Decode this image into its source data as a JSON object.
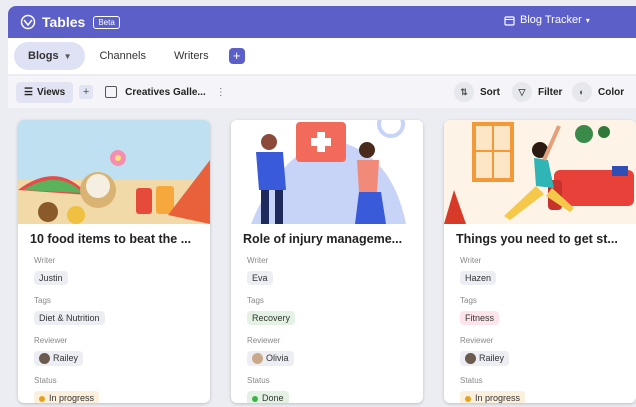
{
  "header": {
    "app_title": "Tables",
    "beta_badge": "Beta",
    "tracker_label": "Blog Tracker",
    "tracker_chevron": "▾"
  },
  "tabs": [
    {
      "label": "Blogs",
      "active": true
    },
    {
      "label": "Channels",
      "active": false
    },
    {
      "label": "Writers",
      "active": false
    }
  ],
  "toolbar": {
    "views_label": "Views",
    "view_name": "Creatives Galle...",
    "sort_label": "Sort",
    "filter_label": "Filter",
    "color_label": "Color"
  },
  "field_labels": {
    "writer": "Writer",
    "tags": "Tags",
    "reviewer": "Reviewer",
    "status": "Status"
  },
  "cards": [
    {
      "title": "10 food items to beat the ...",
      "writer": "Justin",
      "tag": "Diet & Nutrition",
      "tag_color": "gray",
      "reviewer": "Railey",
      "status": "In progress",
      "status_color": "#e5a21f"
    },
    {
      "title": "Role of injury manageme...",
      "writer": "Eva",
      "tag": "Recovery",
      "tag_color": "green",
      "reviewer": "Olivia",
      "status": "Done",
      "status_color": "#3bb34a"
    },
    {
      "title": "Things you need to get st...",
      "writer": "Hazen",
      "tag": "Fitness",
      "tag_color": "pink",
      "reviewer": "Railey",
      "status": "In progress",
      "status_color": "#e5a21f"
    }
  ],
  "colors": {
    "brand": "#5b5fc7",
    "in_progress": "#e5a21f",
    "done": "#3bb34a"
  }
}
